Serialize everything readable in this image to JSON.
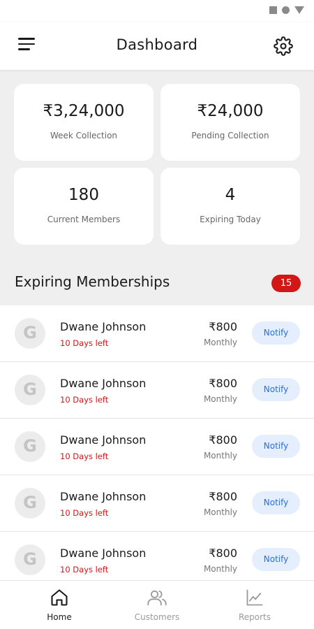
{
  "header": {
    "title": "Dashboard"
  },
  "stats": [
    {
      "value": "₹3,24,000",
      "label": "Week Collection"
    },
    {
      "value": "₹24,000",
      "label": "Pending Collection"
    },
    {
      "value": "180",
      "label": "Current Members"
    },
    {
      "value": "4",
      "label": "Expiring Today"
    }
  ],
  "expiring": {
    "title": "Expiring Memberships",
    "count": "15",
    "items": [
      {
        "avatar": "G",
        "name": "Dwane Johnson",
        "days_left": "10 Days left",
        "price": "₹800",
        "plan": "Monthly",
        "action": "Notify"
      },
      {
        "avatar": "G",
        "name": "Dwane Johnson",
        "days_left": "10 Days left",
        "price": "₹800",
        "plan": "Monthly",
        "action": "Notify"
      },
      {
        "avatar": "G",
        "name": "Dwane Johnson",
        "days_left": "10 Days left",
        "price": "₹800",
        "plan": "Monthly",
        "action": "Notify"
      },
      {
        "avatar": "G",
        "name": "Dwane Johnson",
        "days_left": "10 Days left",
        "price": "₹800",
        "plan": "Monthly",
        "action": "Notify"
      },
      {
        "avatar": "G",
        "name": "Dwane Johnson",
        "days_left": "10 Days left",
        "price": "₹800",
        "plan": "Monthly",
        "action": "Notify"
      }
    ]
  },
  "nav": {
    "items": [
      {
        "label": "Home",
        "icon": "home-icon",
        "active": true
      },
      {
        "label": "Customers",
        "icon": "users-icon",
        "active": false
      },
      {
        "label": "Reports",
        "icon": "chart-icon",
        "active": false
      }
    ]
  },
  "colors": {
    "accent_red": "#d31616",
    "notify_bg": "#e4eefc",
    "notify_text": "#2a6fd6"
  }
}
